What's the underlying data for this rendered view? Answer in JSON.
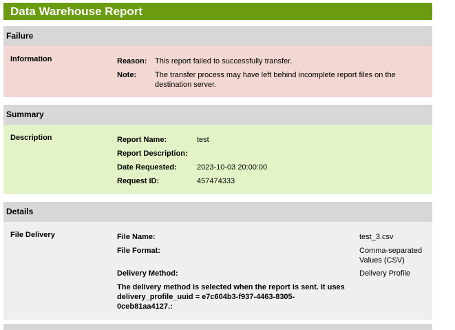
{
  "report": {
    "title": "Data Warehouse Report"
  },
  "failure": {
    "header": "Failure",
    "section_label": "Information",
    "reason_label": "Reason:",
    "reason_value": "This report failed to successfully transfer.",
    "note_label": "Note:",
    "note_value_line1": "The transfer process may have left behind incomplete report files on the",
    "note_value_line2": "destination server."
  },
  "summary": {
    "header": "Summary",
    "section_label": "Description",
    "fields": [
      {
        "label": "Report Name:",
        "value": "test"
      },
      {
        "label": "Report Description:",
        "value": ""
      },
      {
        "label": "Date Requested:",
        "value": "2023-10-03 20:00:00"
      },
      {
        "label": "Request ID:",
        "value": "457474333"
      }
    ]
  },
  "details": {
    "header": "Details",
    "section_label": "File Delivery",
    "file_name_label": "File Name:",
    "file_name_value": "test_3.csv",
    "file_format_label": "File Format:",
    "file_format_value_line1": "Comma-separated",
    "file_format_value_line2": "Values (CSV)",
    "delivery_method_label": "Delivery Method:",
    "delivery_method_value": "Delivery Profile",
    "delivery_note_line1": "The delivery method is selected when the report is sent. It uses",
    "delivery_note_line2": "delivery_profile_uuid = e7c604b3-f937-4463-8305-",
    "delivery_note_line3": "0ceb81aa4127.:"
  }
}
